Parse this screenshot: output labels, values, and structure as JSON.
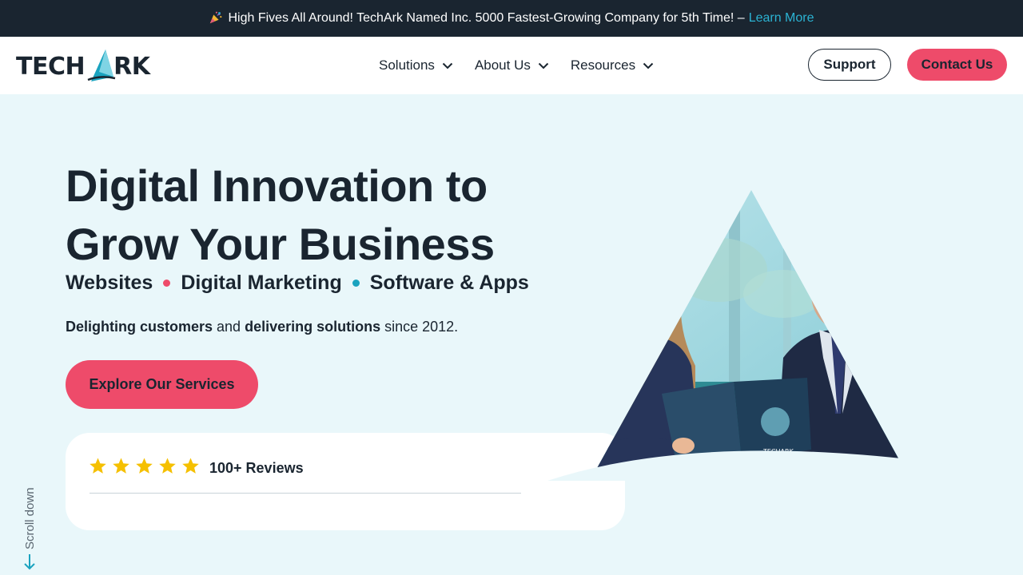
{
  "announcement": {
    "icon": "party-popper-icon",
    "text": "High Fives All Around! TechArk Named Inc. 5000 Fastest-Growing Company for 5th Time! –",
    "link": "Learn More",
    "link_color": "#2bb3d3"
  },
  "header": {
    "logo": {
      "left": "TECH",
      "right": "RK"
    },
    "nav": [
      {
        "label": "Solutions",
        "icon": "chevron-down-icon"
      },
      {
        "label": "About Us",
        "icon": "chevron-down-icon"
      },
      {
        "label": "Resources",
        "icon": "chevron-down-icon"
      }
    ],
    "support_label": "Support",
    "contact_label": "Contact Us"
  },
  "hero": {
    "headline_line1": "Digital Innovation to",
    "headline_line2": "Grow Your Business",
    "services": [
      "Websites",
      "Digital Marketing",
      "Software & Apps"
    ],
    "tagline": {
      "part1": "Delighting customers",
      "part2": " and ",
      "part3": "delivering solutions",
      "part4": " since 2012."
    },
    "cta_label": "Explore Our Services",
    "reviews": {
      "stars": 5,
      "label": "100+ Reviews"
    },
    "scroll_label": "Scroll down"
  },
  "colors": {
    "dark": "#1a2530",
    "accent_pink": "#ee4b6a",
    "accent_teal": "#1aa3bf",
    "hero_bg": "#e9f7fa",
    "star": "#f5c000"
  }
}
